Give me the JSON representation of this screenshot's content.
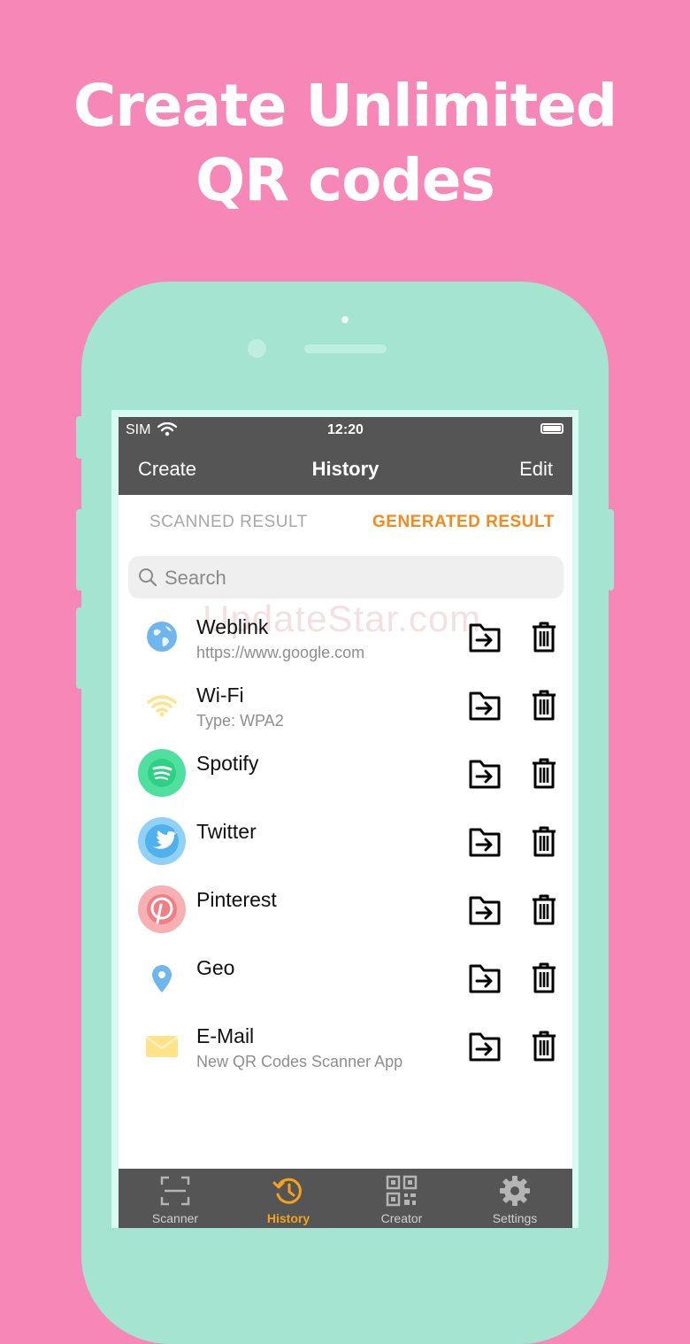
{
  "headline": {
    "line1": "Create Unlimited",
    "line2": "QR codes"
  },
  "colors": {
    "background": "#f787b6",
    "phone": "#a5e4d0",
    "accent": "#f48a1c",
    "bar": "#555555"
  },
  "status": {
    "carrier": "SIM",
    "time": "12:20"
  },
  "nav": {
    "left": "Create",
    "title": "History",
    "right": "Edit"
  },
  "segments": {
    "scanned": "SCANNED RESULT",
    "generated": "GENERATED RESULT",
    "selected": "GENERATED RESULT"
  },
  "search": {
    "placeholder": "Search"
  },
  "watermark": "UpdateStar.com",
  "items": [
    {
      "title": "Weblink",
      "subtitle": "https://www.google.com",
      "icon": "globe-icon"
    },
    {
      "title": "Wi-Fi",
      "subtitle": "Type: WPA2",
      "icon": "wifi-icon"
    },
    {
      "title": "Spotify",
      "subtitle": "",
      "icon": "spotify-icon"
    },
    {
      "title": "Twitter",
      "subtitle": "",
      "icon": "twitter-icon"
    },
    {
      "title": "Pinterest",
      "subtitle": "",
      "icon": "pinterest-icon"
    },
    {
      "title": "Geo",
      "subtitle": "",
      "icon": "location-pin-icon"
    },
    {
      "title": "E-Mail",
      "subtitle": "New QR Codes Scanner App",
      "icon": "envelope-icon"
    }
  ],
  "tabs": [
    {
      "label": "Scanner",
      "icon": "scanner-icon"
    },
    {
      "label": "History",
      "icon": "history-icon",
      "active": true
    },
    {
      "label": "Creator",
      "icon": "qr-code-icon"
    },
    {
      "label": "Settings",
      "icon": "gear-icon"
    }
  ]
}
